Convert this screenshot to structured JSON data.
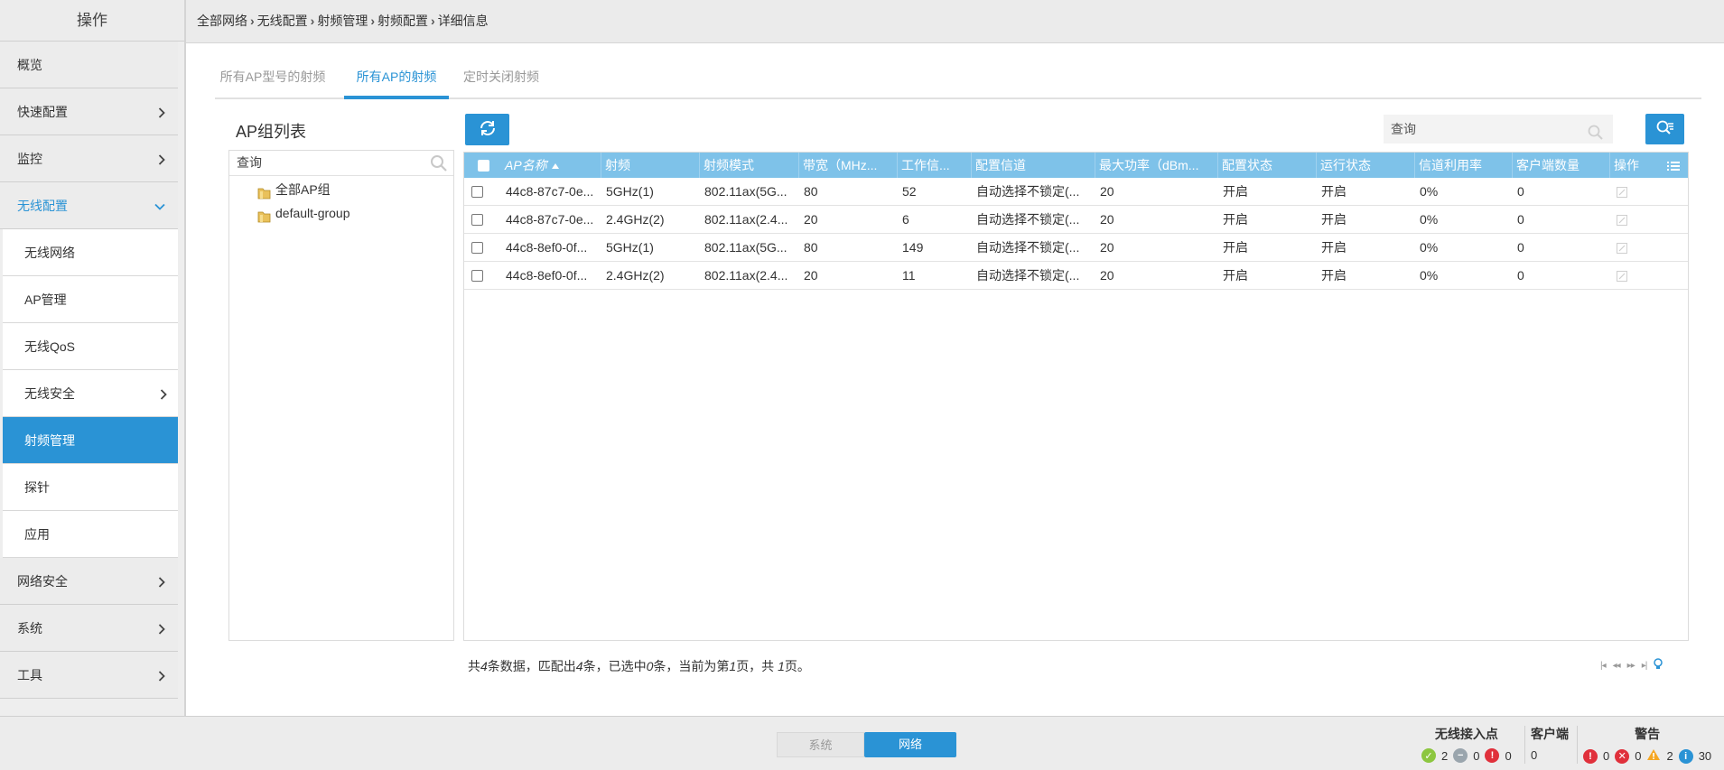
{
  "sidebar": {
    "title": "操作",
    "items": [
      {
        "label": "概览"
      },
      {
        "label": "快速配置"
      },
      {
        "label": "监控"
      },
      {
        "label": "无线配置"
      },
      {
        "label": "网络安全"
      },
      {
        "label": "系统"
      },
      {
        "label": "工具"
      }
    ],
    "sub_items": [
      {
        "label": "无线网络"
      },
      {
        "label": "AP管理"
      },
      {
        "label": "无线QoS"
      },
      {
        "label": "无线安全"
      },
      {
        "label": "射频管理"
      },
      {
        "label": "探针"
      },
      {
        "label": "应用"
      }
    ]
  },
  "breadcrumb": [
    "全部网络",
    "无线配置",
    "射频管理",
    "射频配置",
    "详细信息"
  ],
  "tabs": [
    {
      "label": "所有AP型号的射频"
    },
    {
      "label": "所有AP的射频"
    },
    {
      "label": "定时关闭射频"
    }
  ],
  "group_panel": {
    "title": "AP组列表",
    "search_placeholder": "查询",
    "tree": [
      {
        "label": "全部AP组"
      },
      {
        "label": "default-group"
      }
    ]
  },
  "toolbar": {
    "query_placeholder": "查询"
  },
  "table": {
    "columns": [
      "AP名称",
      "射频",
      "射频模式",
      "带宽（MHz...",
      "工作信...",
      "配置信道",
      "最大功率（dBm...",
      "配置状态",
      "运行状态",
      "信道利用率",
      "客户端数量",
      "操作"
    ],
    "rows": [
      [
        "44c8-87c7-0e...",
        "5GHz(1)",
        "802.11ax(5G...",
        "80",
        "52",
        "自动选择不锁定(...",
        "20",
        "开启",
        "开启",
        "0%",
        "0"
      ],
      [
        "44c8-87c7-0e...",
        "2.4GHz(2)",
        "802.11ax(2.4...",
        "20",
        "6",
        "自动选择不锁定(...",
        "20",
        "开启",
        "开启",
        "0%",
        "0"
      ],
      [
        "44c8-8ef0-0f...",
        "5GHz(1)",
        "802.11ax(5G...",
        "80",
        "149",
        "自动选择不锁定(...",
        "20",
        "开启",
        "开启",
        "0%",
        "0"
      ],
      [
        "44c8-8ef0-0f...",
        "2.4GHz(2)",
        "802.11ax(2.4...",
        "20",
        "11",
        "自动选择不锁定(...",
        "20",
        "开启",
        "开启",
        "0%",
        "0"
      ]
    ]
  },
  "summary": {
    "p1": "共",
    "total": "4",
    "p2": "条数据，匹配出",
    "matched": "4",
    "p3": "条，已选中",
    "selected": "0",
    "p4": "条，当前为第",
    "page": "1",
    "p5": "页，共 ",
    "pages": "1",
    "p6": "页。"
  },
  "bottom": {
    "seg_system": "系统",
    "seg_network": "网络",
    "ap_title": "无线接入点",
    "ap_ok": "2",
    "ap_offline": "0",
    "ap_error": "0",
    "client_title": "客户端",
    "client_count": "0",
    "alarm_title": "警告",
    "alarm_critical": "0",
    "alarm_major": "0",
    "alarm_warning": "2",
    "alarm_info": "30"
  },
  "colors": {
    "accent": "#2a93d5",
    "table_header": "#7ec2e9"
  }
}
